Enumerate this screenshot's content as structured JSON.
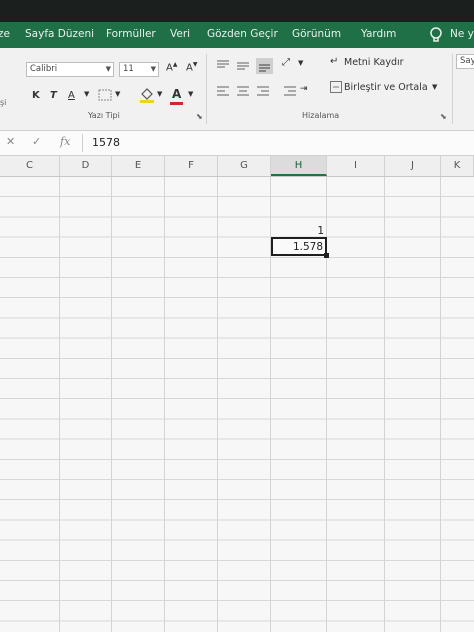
{
  "tabs": [
    {
      "id": "page-layout-partial",
      "label": "ze"
    },
    {
      "id": "page-layout",
      "label": "Sayfa Düzeni"
    },
    {
      "id": "formulas",
      "label": "Formüller"
    },
    {
      "id": "data",
      "label": "Veri"
    },
    {
      "id": "review",
      "label": "Gözden Geçir"
    },
    {
      "id": "view",
      "label": "Görünüm"
    },
    {
      "id": "help",
      "label": "Yardım"
    },
    {
      "id": "tell-me-partial",
      "label": "Ne y"
    }
  ],
  "ribbon": {
    "font_name": "Calibri",
    "font_size": "11",
    "bold_label": "K",
    "italic_label": "T",
    "underline_label": "A",
    "wrap_text_label": "Metni Kaydır",
    "merge_center_label": "Birleştir ve Ortala",
    "font_group_label": "Yazı Tipi",
    "alignment_group_label": "Hizalama",
    "left_partial_label": "şi",
    "right_partial_label": "Say",
    "font_color": "#d22a2a",
    "fill_color": "#f2d21b"
  },
  "formula_bar": {
    "value": "1578",
    "fx_label": "fx"
  },
  "columns": [
    "C",
    "D",
    "E",
    "F",
    "G",
    "H",
    "I",
    "J",
    "K"
  ],
  "active_column": "H",
  "cells": {
    "h_above": "1",
    "h_selected": "1.578"
  },
  "colors": {
    "accent_green": "#217346",
    "tab_bar": "#1f6f47"
  }
}
